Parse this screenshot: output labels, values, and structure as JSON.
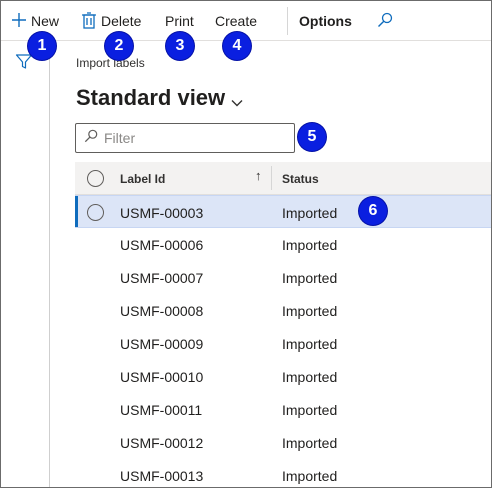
{
  "toolbar": {
    "new_label": "New",
    "delete_label": "Delete",
    "print_label": "Print",
    "create_label": "Create",
    "options_label": "Options"
  },
  "icons": {
    "new": "plus-icon",
    "delete": "trash-icon",
    "search": "search-icon",
    "filter": "filter-icon",
    "view_menu": "chevron-down-icon",
    "sort": "sort-ascending-icon"
  },
  "page": {
    "breadcrumb": "Import labels",
    "view_title": "Standard view"
  },
  "filter": {
    "placeholder": "Filter"
  },
  "grid": {
    "columns": {
      "label_id": "Label Id",
      "sort_indicator": "↑",
      "status": "Status"
    },
    "rows": [
      {
        "label_id": "USMF-00003",
        "status": "Imported",
        "selected": true
      },
      {
        "label_id": "USMF-00006",
        "status": "Imported",
        "selected": false
      },
      {
        "label_id": "USMF-00007",
        "status": "Imported",
        "selected": false
      },
      {
        "label_id": "USMF-00008",
        "status": "Imported",
        "selected": false
      },
      {
        "label_id": "USMF-00009",
        "status": "Imported",
        "selected": false
      },
      {
        "label_id": "USMF-00010",
        "status": "Imported",
        "selected": false
      },
      {
        "label_id": "USMF-00011",
        "status": "Imported",
        "selected": false
      },
      {
        "label_id": "USMF-00012",
        "status": "Imported",
        "selected": false
      },
      {
        "label_id": "USMF-00013",
        "status": "Imported",
        "selected": false
      }
    ]
  },
  "callouts": [
    "1",
    "2",
    "3",
    "4",
    "5",
    "6"
  ],
  "colors": {
    "accent": "#0f6cbd",
    "selected_row": "#dce5f7",
    "callout": "#0a1fe0"
  }
}
